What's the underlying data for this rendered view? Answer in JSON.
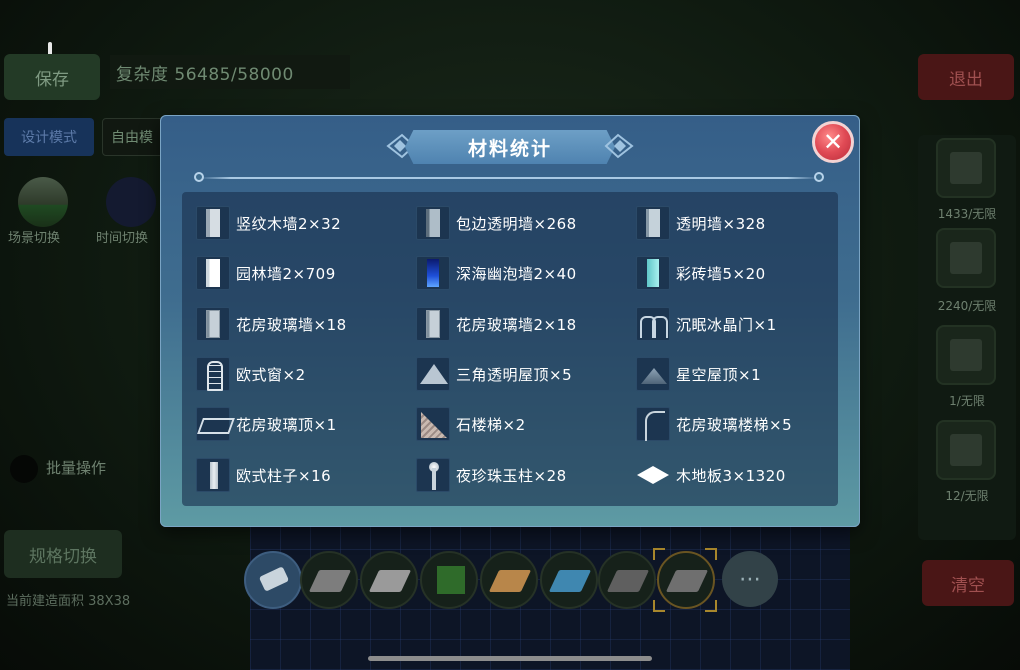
{
  "background": {
    "save_label": "保存",
    "complexity_label": "复杂度 56485/58000",
    "exit_label": "退出",
    "design_mode_label": "设计模式",
    "free_mode_label": "自由模",
    "scene_switch_label": "场景切换",
    "time_switch_label": "时间切换",
    "batch_label": "批量操作",
    "spec_switch_label": "规格切换",
    "build_area_label": "当前建造面积 38X38",
    "clear_label": "清空",
    "side_counts": [
      "1433/无限",
      "2240/无限",
      "1/无限",
      "12/无限"
    ],
    "more_label": "⋯"
  },
  "dialog": {
    "title": "材料统计",
    "close_label": "✕",
    "items": [
      {
        "label": "竖纹木墙2×32",
        "icon": "vertical-wood-wall-icon"
      },
      {
        "label": "包边透明墙×268",
        "icon": "edged-clear-wall-icon"
      },
      {
        "label": "透明墙×328",
        "icon": "clear-wall-icon"
      },
      {
        "label": "园林墙2×709",
        "icon": "garden-wall-icon"
      },
      {
        "label": "深海幽泡墙2×40",
        "icon": "deep-sea-bubble-wall-icon"
      },
      {
        "label": "彩砖墙5×20",
        "icon": "color-brick-wall-icon"
      },
      {
        "label": "花房玻璃墙×18",
        "icon": "greenhouse-glass-wall-icon"
      },
      {
        "label": "花房玻璃墙2×18",
        "icon": "greenhouse-glass-wall-2-icon"
      },
      {
        "label": "沉眠冰晶门×1",
        "icon": "ice-crystal-gate-icon"
      },
      {
        "label": "欧式窗×2",
        "icon": "european-window-icon"
      },
      {
        "label": "三角透明屋顶×5",
        "icon": "triangle-glass-roof-icon"
      },
      {
        "label": "星空屋顶×1",
        "icon": "starry-roof-icon"
      },
      {
        "label": "花房玻璃顶×1",
        "icon": "greenhouse-glass-roof-icon"
      },
      {
        "label": "石楼梯×2",
        "icon": "stone-stairs-icon"
      },
      {
        "label": "花房玻璃楼梯×5",
        "icon": "greenhouse-glass-stairs-icon"
      },
      {
        "label": "欧式柱子×16",
        "icon": "european-column-icon"
      },
      {
        "label": "夜珍珠玉柱×28",
        "icon": "night-pearl-pillar-icon"
      },
      {
        "label": "木地板3×1320",
        "icon": "wood-floor-icon"
      }
    ]
  },
  "colors": {
    "dialog_top": "#355e88",
    "dialog_bottom": "#5e9ba4",
    "close_red": "#e04a55",
    "exit_red": "#4a1616",
    "design_blue": "#17335a"
  }
}
